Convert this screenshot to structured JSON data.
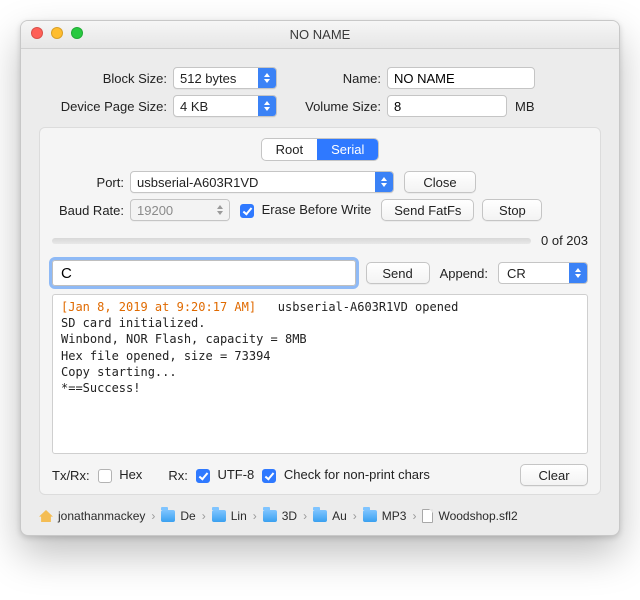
{
  "window": {
    "title": "NO NAME"
  },
  "form": {
    "blockSizeLabel": "Block Size:",
    "blockSizeValue": "512 bytes",
    "devicePageSizeLabel": "Device Page Size:",
    "devicePageSizeValue": "4 KB",
    "nameLabel": "Name:",
    "nameValue": "NO NAME",
    "volumeSizeLabel": "Volume Size:",
    "volumeSizeValue": "8",
    "volumeSizeUnit": "MB"
  },
  "tabs": {
    "root": "Root",
    "serial": "Serial"
  },
  "serial": {
    "portLabel": "Port:",
    "portValue": "usbserial-A603R1VD",
    "closeBtn": "Close",
    "baudLabel": "Baud Rate:",
    "baudValue": "19200",
    "eraseLabel": "Erase Before Write",
    "sendFatFsBtn": "Send FatFs",
    "stopBtn": "Stop",
    "progressText": "0 of 203"
  },
  "send": {
    "inputValue": "C",
    "sendBtn": "Send",
    "appendLabel": "Append:",
    "appendValue": "CR"
  },
  "log": {
    "timestamp": "[Jan 8, 2019 at 9:20:17 AM]",
    "opened": "usbserial-A603R1VD opened",
    "l1": "SD card initialized.",
    "l2": "Winbond, NOR Flash, capacity = 8MB",
    "l3": "Hex file opened, size = 73394",
    "l4": "Copy starting...",
    "l5": "*==Success!"
  },
  "bottom": {
    "txrxLabel": "Tx/Rx:",
    "hexLabel": "Hex",
    "rxLabel": "Rx:",
    "utf8Label": "UTF-8",
    "nonprintLabel": "Check for non-print chars",
    "clearBtn": "Clear"
  },
  "crumbs": {
    "c0": "jonathanmackey",
    "c1": "De",
    "c2": "Lin",
    "c3": "3D",
    "c4": "Au",
    "c5": "MP3",
    "file": "Woodshop.sfl2"
  }
}
